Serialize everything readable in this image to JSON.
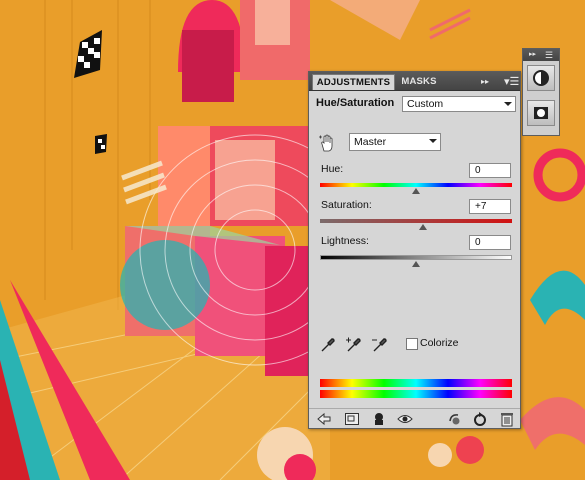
{
  "panel": {
    "tabs": [
      "ADJUSTMENTS",
      "MASKS"
    ],
    "collapse_glyph": "▸▸",
    "menu_glyph": "▾☰",
    "title": "Hue/Saturation",
    "preset": "Custom",
    "channel": "Master",
    "sliders": [
      {
        "label": "Hue:",
        "value": "0",
        "level_fraction": 0.5
      },
      {
        "label": "Saturation:",
        "value": "+7",
        "level_fraction": 0.535
      },
      {
        "label": "Lightness:",
        "value": "0",
        "level_fraction": 0.5
      }
    ],
    "colorize_label": "Colorize",
    "colorize_checked": false,
    "icons": {
      "tool": "hand-scrubby-icon",
      "eyedroppers": [
        "eyedropper-icon",
        "eyedropper-plus-icon",
        "eyedropper-minus-icon"
      ],
      "bottom": [
        "back-arrow-icon",
        "expand-view-icon",
        "clip-layer-icon",
        "visibility-eye-icon",
        "previous-state-icon",
        "reset-icon",
        "trash-icon"
      ]
    }
  },
  "toolstrip": {
    "header_glyph": "▸▸",
    "menu_glyph": "☰",
    "icons": [
      "adjustments-panel-icon",
      "masks-panel-icon"
    ]
  },
  "colors": {
    "background": "#e99e2a",
    "panel": "#d6d6d6",
    "panel_header": "#4e4e4e"
  }
}
